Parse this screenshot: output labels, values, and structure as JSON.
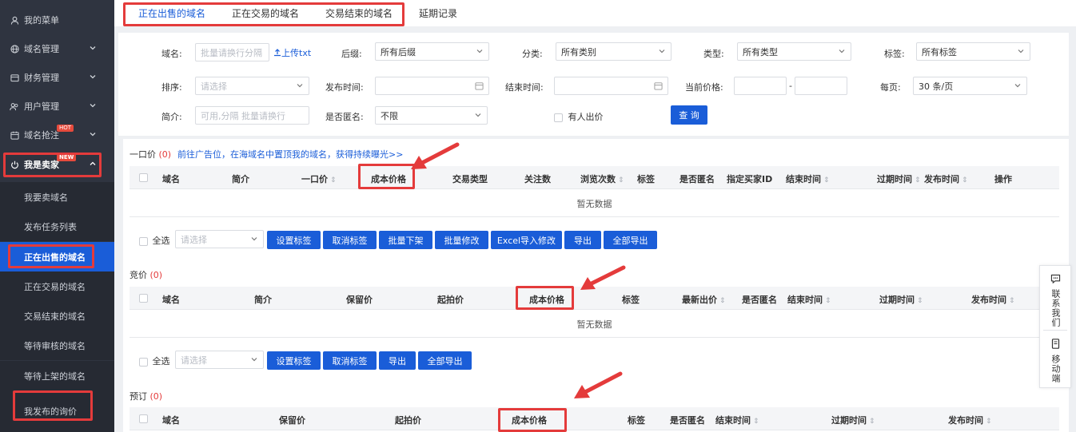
{
  "sidebar": {
    "items": [
      {
        "label": "我的菜单",
        "icon": "user-icon"
      },
      {
        "label": "域名管理",
        "icon": "globe-icon"
      },
      {
        "label": "财务管理",
        "icon": "wallet-icon"
      },
      {
        "label": "用户管理",
        "icon": "users-icon"
      },
      {
        "label": "域名抢注",
        "icon": "calendar-icon",
        "badge": "HOT"
      },
      {
        "label": "我是卖家",
        "icon": "power-icon",
        "badge": "NEW"
      }
    ],
    "sub_items": [
      {
        "label": "我要卖域名"
      },
      {
        "label": "发布任务列表"
      },
      {
        "label": "正在出售的域名"
      },
      {
        "label": "正在交易的域名"
      },
      {
        "label": "交易结束的域名"
      },
      {
        "label": "等待审核的域名"
      },
      {
        "label": "等待上架的域名"
      },
      {
        "label": "我发布的询价"
      }
    ]
  },
  "tabs": [
    {
      "label": "正在出售的域名"
    },
    {
      "label": "正在交易的域名"
    },
    {
      "label": "交易结束的域名"
    },
    {
      "label": "延期记录"
    }
  ],
  "filters": {
    "domain_label": "域名:",
    "domain_placeholder": "批量请换行分隔",
    "upload_label": "上传txt",
    "suffix_label": "后缀:",
    "suffix_value": "所有后缀",
    "category_label": "分类:",
    "category_value": "所有类别",
    "type_label": "类型:",
    "type_value": "所有类型",
    "tag_label": "标签:",
    "tag_value": "所有标签",
    "sort_label": "排序:",
    "sort_placeholder": "请选择",
    "publish_time_label": "发布时间:",
    "end_time_label": "结束时间:",
    "price_label": "当前价格:",
    "price_sep": "-",
    "per_page_label": "每页:",
    "per_page_value": "30 条/页",
    "intro_label": "简介:",
    "intro_placeholder": "可用,分隔 批量请换行",
    "anon_label": "是否匿名:",
    "anon_value": "不限",
    "bid_label": "有人出价",
    "query_button": "查 询"
  },
  "section_fixed": {
    "title": "一口价",
    "count": "(0)",
    "notice": "前往广告位，在海域名中置顶我的域名，获得持续曝光>>",
    "columns": [
      "域名",
      "简介",
      "一口价",
      "成本价格",
      "交易类型",
      "关注数",
      "浏览次数",
      "标签",
      "是否匿名",
      "指定买家ID",
      "结束时间",
      "过期时间",
      "发布时间",
      "操作"
    ],
    "empty": "暂无数据",
    "select_all": "全选",
    "select_placeholder": "请选择",
    "buttons": [
      "设置标签",
      "取消标签",
      "批量下架",
      "批量修改",
      "Excel导入修改",
      "导出",
      "全部导出"
    ]
  },
  "section_auction": {
    "title": "竞价",
    "count": "(0)",
    "columns": [
      "域名",
      "简介",
      "保留价",
      "起拍价",
      "成本价格",
      "标签",
      "最新出价",
      "是否匿名",
      "结束时间",
      "过期时间",
      "发布时间"
    ],
    "empty": "暂无数据",
    "select_all": "全选",
    "select_placeholder": "请选择",
    "buttons": [
      "设置标签",
      "取消标签",
      "导出",
      "全部导出"
    ]
  },
  "section_reserve": {
    "title": "预订",
    "count": "(0)",
    "columns": [
      "域名",
      "保留价",
      "起拍价",
      "成本价格",
      "标签",
      "是否匿名",
      "结束时间",
      "过期时间",
      "发布时间"
    ]
  },
  "float_panel": {
    "contact_label": "联系我们",
    "mobile_label": "移动端"
  },
  "colors": {
    "accent": "#1a5dd8",
    "sidebar_bg": "#2f3440",
    "highlight_red": "#e43b3b"
  }
}
